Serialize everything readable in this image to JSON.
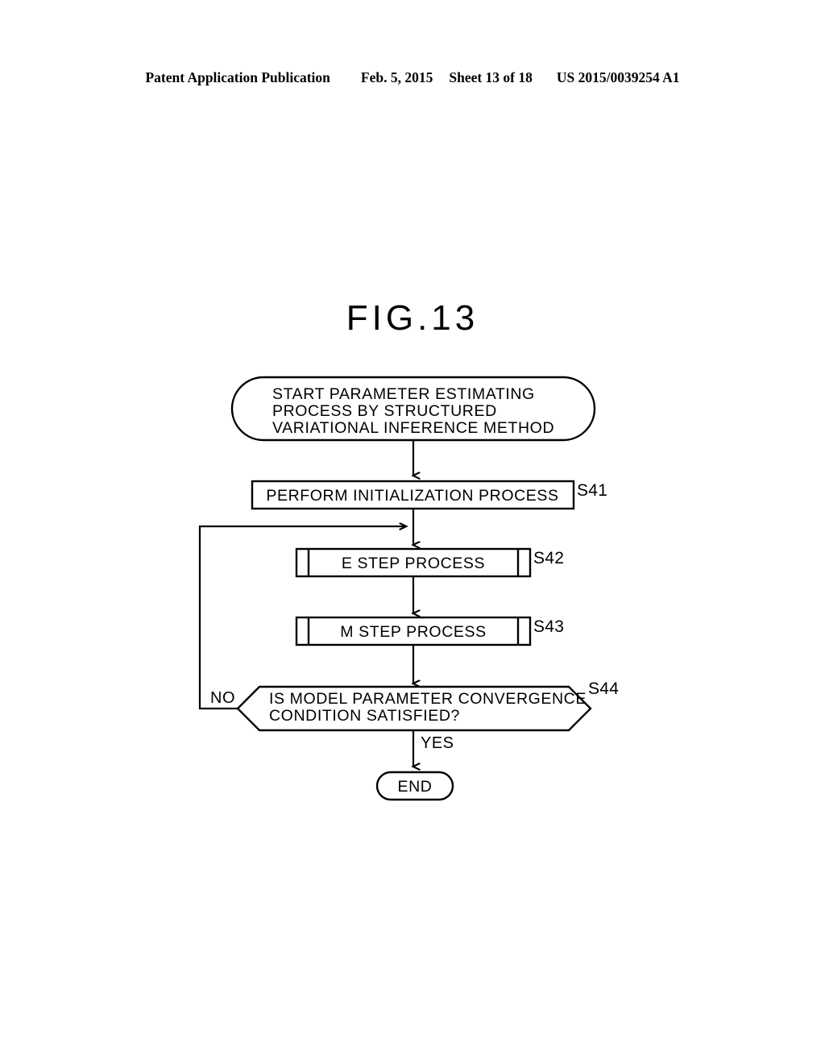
{
  "header": {
    "publication": "Patent Application Publication",
    "date": "Feb. 5, 2015",
    "sheet": "Sheet 13 of 18",
    "patent_number": "US 2015/0039254 A1"
  },
  "figure": {
    "title": "FIG.13"
  },
  "flowchart": {
    "start": {
      "shape": "terminator",
      "line1": "START PARAMETER ESTIMATING",
      "line2": "PROCESS BY STRUCTURED",
      "line3": "VARIATIONAL INFERENCE METHOD"
    },
    "steps": [
      {
        "id": "S41",
        "shape": "process",
        "label": "PERFORM INITIALIZATION PROCESS",
        "step_number": "S41"
      },
      {
        "id": "S42",
        "shape": "predefined-process",
        "label": "E STEP PROCESS",
        "step_number": "S42"
      },
      {
        "id": "S43",
        "shape": "predefined-process",
        "label": "M STEP PROCESS",
        "step_number": "S43"
      }
    ],
    "decision": {
      "id": "S44",
      "shape": "hexagon",
      "line1": "IS MODEL PARAMETER CONVERGENCE",
      "line2": "CONDITION SATISFIED?",
      "step_number": "S44",
      "branch_no": "NO",
      "branch_yes": "YES"
    },
    "end": {
      "shape": "terminator",
      "label": "END"
    },
    "colors": {
      "stroke": "#000000",
      "fill": "#ffffff",
      "text": "#000000"
    }
  }
}
